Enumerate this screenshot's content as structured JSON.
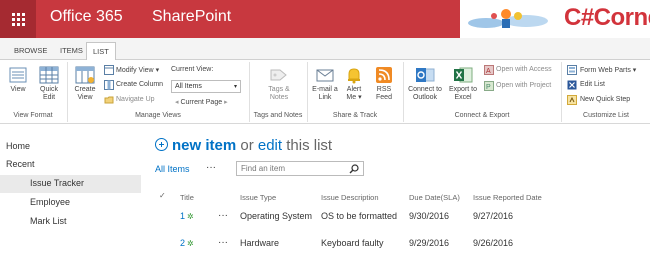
{
  "suite": {
    "brand": "Office 365",
    "app": "SharePoint",
    "logo_text": "C#Corner"
  },
  "ribbon_tabs": [
    "BROWSE",
    "ITEMS",
    "LIST"
  ],
  "ribbon": {
    "view_format": {
      "view": "View",
      "quick_edit": [
        "Quick",
        "Edit"
      ],
      "label": "View Format"
    },
    "manage_views": {
      "create_view": [
        "Create",
        "View"
      ],
      "modify_view": "Modify View",
      "create_column": "Create Column",
      "navigate_up": "Navigate Up",
      "current_view_label": "Current View:",
      "current_view_value": "All Items",
      "current_page": "Current Page",
      "label": "Manage Views"
    },
    "tags_notes": {
      "button": [
        "Tags &",
        "Notes"
      ],
      "label": "Tags and Notes"
    },
    "share_track": {
      "email": [
        "E-mail a",
        "Link"
      ],
      "alert": [
        "Alert",
        "Me"
      ],
      "rss": [
        "RSS",
        "Feed"
      ],
      "label": "Share & Track"
    },
    "connect_export": {
      "outlook": [
        "Connect to",
        "Outlook"
      ],
      "excel": [
        "Export to",
        "Excel"
      ],
      "open_access": "Open with Access",
      "open_project": "Open with Project",
      "label": "Connect & Export"
    },
    "customize_list": {
      "form_web_parts": "Form Web Parts",
      "edit_list": "Edit List",
      "new_quick_step": "New Quick Step",
      "label": "Customize List"
    }
  },
  "nav": {
    "home": "Home",
    "recent": "Recent",
    "items": [
      "Issue Tracker",
      "Employee",
      "Mark List"
    ]
  },
  "main": {
    "new_item": "new item",
    "or": "or",
    "edit": "edit",
    "this_list": "this list",
    "view_name": "All Items",
    "more": "···",
    "search_placeholder": "Find an item",
    "columns": [
      "Title",
      "Issue Type",
      "Issue Description",
      "Due Date(SLA)",
      "Issue Reported Date"
    ],
    "rows": [
      {
        "title": "1",
        "type": "Operating System",
        "description": "OS to be formatted",
        "due": "9/30/2016",
        "reported": "9/27/2016"
      },
      {
        "title": "2",
        "type": "Hardware",
        "description": "Keyboard faulty",
        "due": "9/29/2016",
        "reported": "9/26/2016"
      }
    ]
  },
  "colors": {
    "suite_bar": "#c8383f",
    "link_blue": "#0072c6",
    "logo_red": "#d2333b"
  }
}
